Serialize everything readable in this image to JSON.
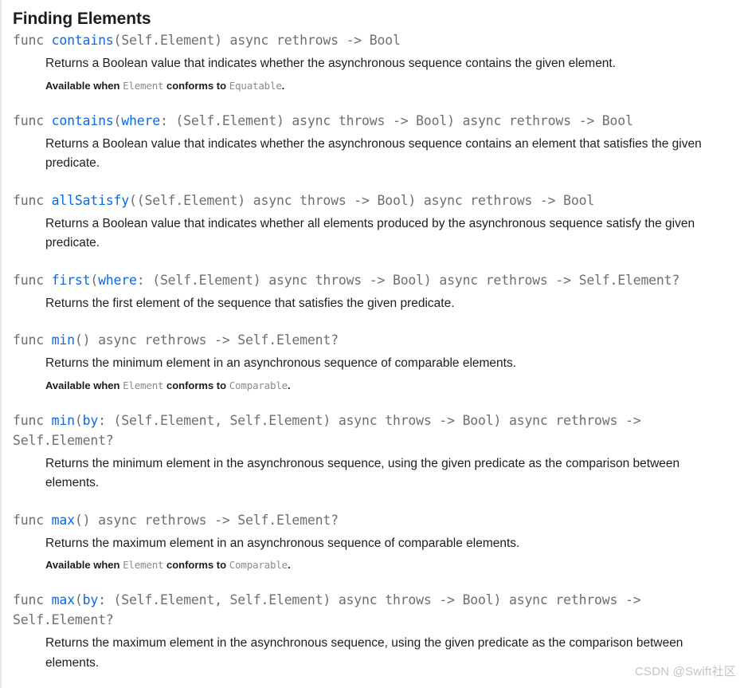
{
  "page": {
    "title": "Finding Elements",
    "watermark": "CSDN @Swift社区",
    "accent_color": "#0b6ae8",
    "code_color": "#6e6e73",
    "text_color": "#1d1d1f"
  },
  "topics": [
    {
      "id": "contains",
      "signature": {
        "keyword": "func",
        "name": "contains",
        "before_arg": "(",
        "arg_label": "",
        "rest": "Self.Element) async rethrows -> Bool",
        "full": "func contains(Self.Element) async rethrows -> Bool"
      },
      "abstract": "Returns a Boolean value that indicates whether the asynchronous sequence contains the given element.",
      "conformance": {
        "prefix": "Available when",
        "type": "Element",
        "middle": "conforms to",
        "protocol": "Equatable",
        "suffix": "."
      }
    },
    {
      "id": "contains-where",
      "signature": {
        "keyword": "func",
        "name": "contains",
        "before_arg": "(",
        "arg_label": "where",
        "rest": ": (Self.Element) async throws -> Bool) async rethrows -> Bool",
        "full": "func contains(where: (Self.Element) async throws -> Bool) async rethrows -> Bool"
      },
      "abstract": "Returns a Boolean value that indicates whether the asynchronous sequence contains an element that satisfies the given predicate.",
      "conformance": null
    },
    {
      "id": "allSatisfy",
      "signature": {
        "keyword": "func",
        "name": "allSatisfy",
        "before_arg": "(",
        "arg_label": "",
        "rest": "(Self.Element) async throws -> Bool) async rethrows -> Bool",
        "full": "func allSatisfy((Self.Element) async throws -> Bool) async rethrows -> Bool"
      },
      "abstract": "Returns a Boolean value that indicates whether all elements produced by the asynchronous sequence satisfy the given predicate.",
      "conformance": null
    },
    {
      "id": "first-where",
      "signature": {
        "keyword": "func",
        "name": "first",
        "before_arg": "(",
        "arg_label": "where",
        "rest": ": (Self.Element) async throws -> Bool) async rethrows -> Self.Element?",
        "full": "func first(where: (Self.Element) async throws -> Bool) async rethrows -> Self.Element?"
      },
      "abstract": "Returns the first element of the sequence that satisfies the given predicate.",
      "conformance": null
    },
    {
      "id": "min",
      "signature": {
        "keyword": "func",
        "name": "min",
        "before_arg": "",
        "arg_label": "",
        "rest": "() async rethrows -> Self.Element?",
        "full": "func min() async rethrows -> Self.Element?"
      },
      "abstract": "Returns the minimum element in an asynchronous sequence of comparable elements.",
      "conformance": {
        "prefix": "Available when",
        "type": "Element",
        "middle": "conforms to",
        "protocol": "Comparable",
        "suffix": "."
      }
    },
    {
      "id": "min-by",
      "signature": {
        "keyword": "func",
        "name": "min",
        "before_arg": "(",
        "arg_label": "by",
        "rest": ": (Self.Element, Self.Element) async throws -> Bool) async rethrows -> Self.Element?",
        "full": "func min(by: (Self.Element, Self.Element) async throws -> Bool) async rethrows -> Self.Element?"
      },
      "abstract": "Returns the minimum element in the asynchronous sequence, using the given predicate as the comparison between elements.",
      "conformance": null
    },
    {
      "id": "max",
      "signature": {
        "keyword": "func",
        "name": "max",
        "before_arg": "",
        "arg_label": "",
        "rest": "() async rethrows -> Self.Element?",
        "full": "func max() async rethrows -> Self.Element?"
      },
      "abstract": "Returns the maximum element in an asynchronous sequence of comparable elements.",
      "conformance": {
        "prefix": "Available when",
        "type": "Element",
        "middle": "conforms to",
        "protocol": "Comparable",
        "suffix": "."
      }
    },
    {
      "id": "max-by",
      "signature": {
        "keyword": "func",
        "name": "max",
        "before_arg": "(",
        "arg_label": "by",
        "rest": ": (Self.Element, Self.Element) async throws -> Bool) async rethrows -> Self.Element?",
        "full": "func max(by: (Self.Element, Self.Element) async throws -> Bool) async rethrows -> Self.Element?"
      },
      "abstract": "Returns the maximum element in the asynchronous sequence, using the given predicate as the comparison between elements.",
      "conformance": null
    }
  ]
}
